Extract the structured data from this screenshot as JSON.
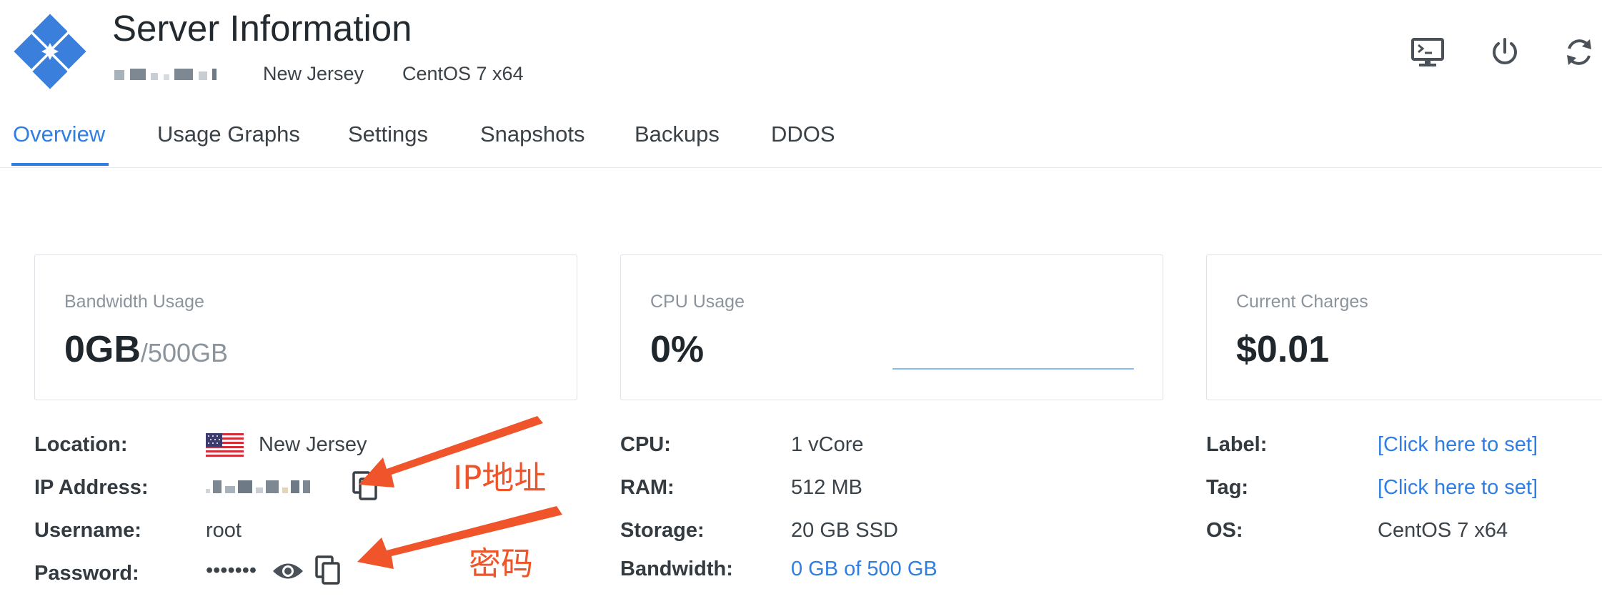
{
  "header": {
    "title": "Server Information",
    "location": "New Jersey",
    "os": "CentOS 7 x64",
    "brand_color": "#3b7fdc",
    "icons": [
      "console-icon",
      "power-icon",
      "refresh-icon"
    ]
  },
  "tabs": [
    "Overview",
    "Usage Graphs",
    "Settings",
    "Snapshots",
    "Backups",
    "DDOS"
  ],
  "active_tab": "Overview",
  "cards": {
    "bandwidth": {
      "label": "Bandwidth Usage",
      "value": "0GB",
      "limit": "/500GB"
    },
    "cpu": {
      "label": "CPU Usage",
      "value": "0%"
    },
    "charges": {
      "label": "Current Charges",
      "value": "$0.01"
    }
  },
  "info_left": {
    "location": {
      "label": "Location:",
      "value": "New Jersey"
    },
    "ip": {
      "label": "IP Address:"
    },
    "username": {
      "label": "Username:",
      "value": "root"
    },
    "password": {
      "label": "Password:",
      "value": "•••••••"
    }
  },
  "info_mid": {
    "cpu": {
      "label": "CPU:",
      "value": "1 vCore"
    },
    "ram": {
      "label": "RAM:",
      "value": "512 MB"
    },
    "storage": {
      "label": "Storage:",
      "value": "20 GB SSD"
    },
    "bandwidth": {
      "label": "Bandwidth:",
      "value": "0 GB of 500 GB"
    }
  },
  "info_right": {
    "label": {
      "label": "Label:",
      "value": "[Click here to set]"
    },
    "tag": {
      "label": "Tag:",
      "value": "[Click here to set]"
    },
    "os": {
      "label": "OS:",
      "value": "CentOS 7 x64"
    }
  },
  "annotations": {
    "ip": "IP地址",
    "password": "密码",
    "arrow_color": "#f0542a"
  }
}
